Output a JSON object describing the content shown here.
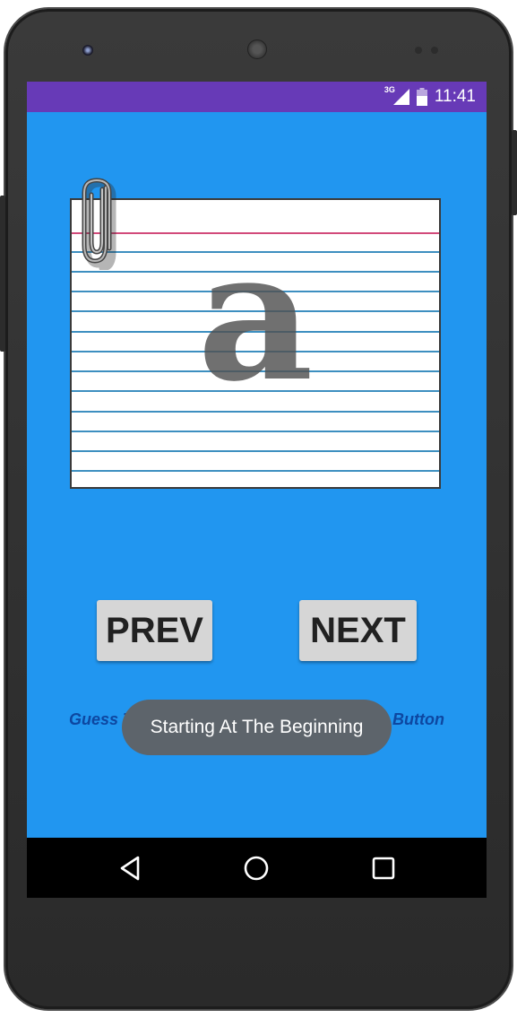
{
  "status_bar": {
    "network_label": "3G",
    "time": "11:41",
    "signal_icon": "signal-icon",
    "battery_icon": "battery-icon"
  },
  "flashcard": {
    "letter": "a"
  },
  "buttons": {
    "prev_label": "PREV",
    "next_label": "NEXT"
  },
  "hint_text": "Guess The Next Card Before Clicking The Button",
  "toast_text": "Starting At The Beginning",
  "nav_bar": {
    "back_icon": "back-icon",
    "home_icon": "home-icon",
    "recents_icon": "recents-icon"
  },
  "colors": {
    "app_background": "#2196f0",
    "status_bar": "#673ab7",
    "button": "#d6d6d6",
    "toast": "#5d646b",
    "hint_text": "#0d47a1"
  }
}
